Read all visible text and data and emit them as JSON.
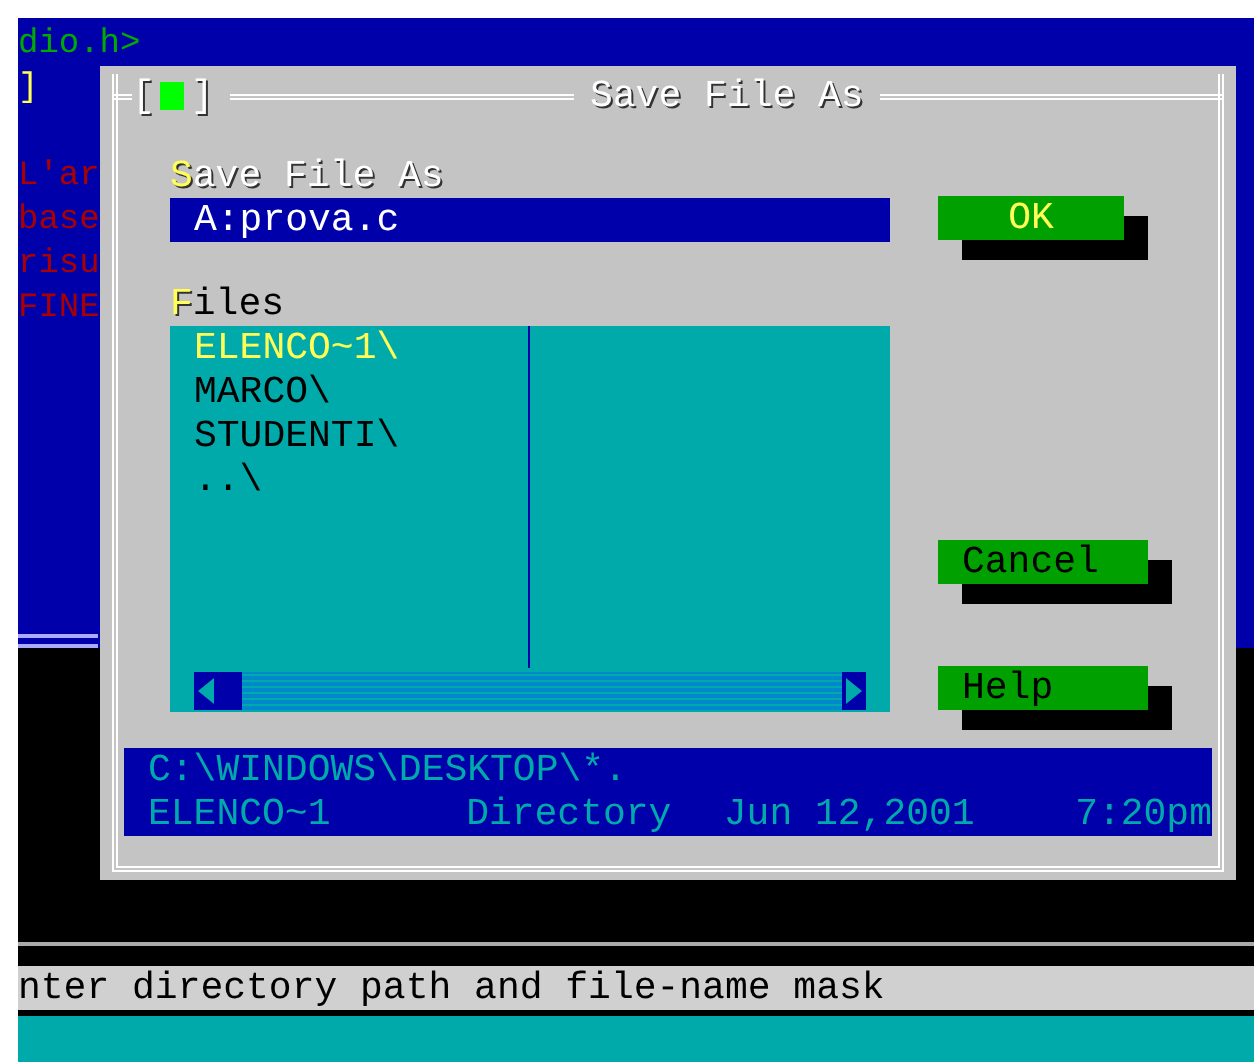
{
  "editor": {
    "lines": [
      {
        "text": "dio.h>",
        "color": "#00aa00"
      },
      {
        "text": "]",
        "color": "#ffff55"
      },
      {
        "text": "L'ar",
        "color": "#aa0000"
      },
      {
        "text": "base",
        "color": "#aa0000"
      },
      {
        "text": "risu",
        "color": "#aa0000"
      },
      {
        "text": "FINE",
        "color": "#aa0000"
      }
    ]
  },
  "dialog": {
    "close_left": "[",
    "close_right": "]",
    "title": "Save File As",
    "name_label": "**S**ave File As",
    "name_value": "A:prova.c",
    "files_label": "**F**iles",
    "files": [
      {
        "name": "ELENCO~1\\",
        "selected": true
      },
      {
        "name": "MARCO\\",
        "selected": false
      },
      {
        "name": "STUDENTI\\",
        "selected": false
      },
      {
        "name": "..\\",
        "selected": false
      }
    ],
    "buttons": [
      {
        "label": "OK",
        "default": true
      },
      {
        "label": "Cancel",
        "default": false
      },
      {
        "label": "Help",
        "default": false
      }
    ],
    "info": {
      "path": "C:\\WINDOWS\\DESKTOP\\*.",
      "name": "ELENCO~1",
      "type": "Directory",
      "date": "Jun 12,2001",
      "time": "7:20pm"
    }
  },
  "status_bar": "nter directory path and file-name mask"
}
